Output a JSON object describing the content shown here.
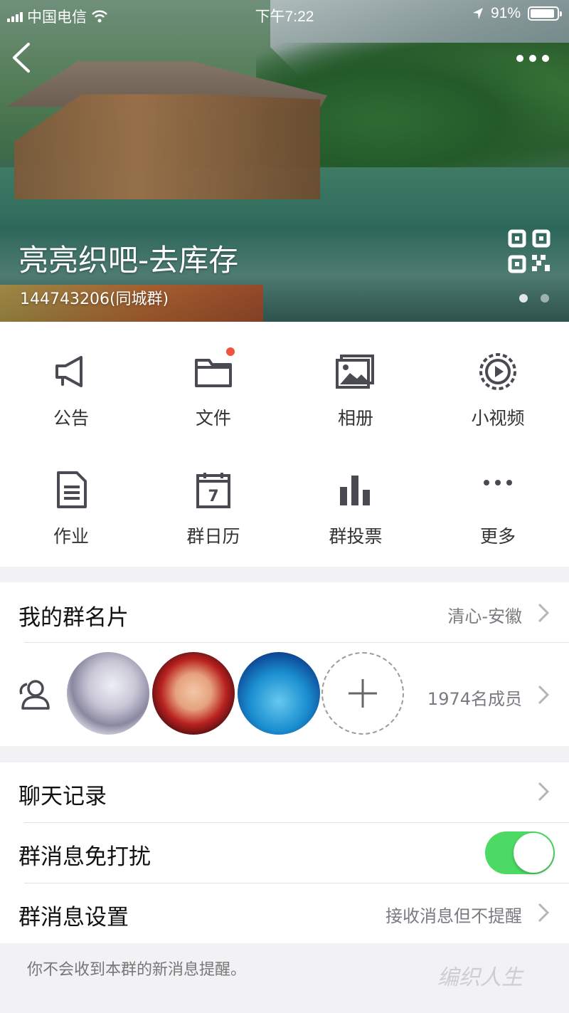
{
  "status_bar": {
    "carrier": "中国电信",
    "time": "下午7:22",
    "battery_percent": "91%",
    "battery_level": 0.91
  },
  "header": {
    "group_name": "亮亮织吧-去库存",
    "group_id": "144743206(同城群)"
  },
  "features": [
    {
      "label": "公告",
      "icon": "megaphone-icon"
    },
    {
      "label": "文件",
      "icon": "folder-icon",
      "badge": true
    },
    {
      "label": "相册",
      "icon": "photo-album-icon"
    },
    {
      "label": "小视频",
      "icon": "video-play-icon"
    },
    {
      "label": "作业",
      "icon": "document-icon"
    },
    {
      "label": "群日历",
      "icon": "calendar-icon",
      "calendar_day": "7"
    },
    {
      "label": "群投票",
      "icon": "bar-chart-icon"
    },
    {
      "label": "更多",
      "icon": "more-dots-icon"
    }
  ],
  "my_card": {
    "title": "我的群名片",
    "value": "清心-安徽"
  },
  "members": {
    "count_label": "1974名成员"
  },
  "chat_history": {
    "title": "聊天记录"
  },
  "dnd": {
    "title": "群消息免打扰",
    "enabled": true
  },
  "msg_settings": {
    "title": "群消息设置",
    "value": "接收消息但不提醒"
  },
  "footer": {
    "note": "你不会收到本群的新消息提醒。"
  },
  "watermark": "编织人生",
  "colors": {
    "badge": "#f0533f",
    "toggle_on": "#4cd964",
    "icon": "#4a4a52",
    "secondary_text": "#7a7a80"
  }
}
